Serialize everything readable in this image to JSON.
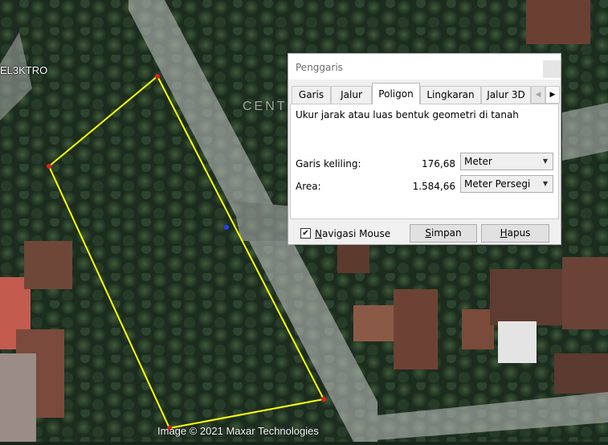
{
  "map": {
    "label_left": "EL3KTRO",
    "label_road": "CENT",
    "attribution": "Image © 2021 Maxar Technologies"
  },
  "dialog": {
    "title": "Penggaris",
    "tabs": [
      {
        "label": "Garis",
        "active": false
      },
      {
        "label": "Jalur",
        "active": false
      },
      {
        "label": "Poligon",
        "active": true
      },
      {
        "label": "Lingkaran",
        "active": false
      },
      {
        "label": "Jalur 3D",
        "active": false
      }
    ],
    "description": "Ukur jarak atau luas bentuk geometri di tanah",
    "perimeter": {
      "label": "Garis keliling:",
      "value": "176,68",
      "unit": "Meter"
    },
    "area": {
      "label": "Area:",
      "value": "1.584,66",
      "unit": "Meter Persegi"
    },
    "mouse_nav": {
      "label_rest": "avigasi Mouse",
      "mnemonic": "N",
      "checked": true
    },
    "buttons": {
      "save": {
        "mnemonic": "S",
        "rest": "impan"
      },
      "clear": {
        "mnemonic": "H",
        "rest": "apus"
      }
    }
  },
  "colors": {
    "polygon_line": "#ffff00",
    "vertex": "#e02020",
    "midpoint": "#2040ff"
  }
}
